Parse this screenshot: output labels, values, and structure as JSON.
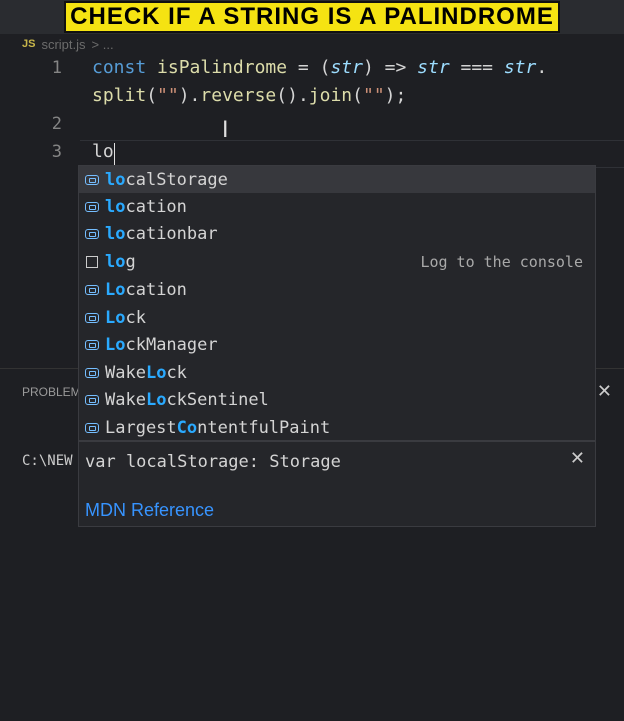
{
  "banner": {
    "title": "CHECK IF A STRING IS A PALINDROME"
  },
  "tab": {
    "badge": "JS",
    "filename": "script.js",
    "breadcrumb_sep": "> ..."
  },
  "editor": {
    "line_numbers": [
      "1",
      "2",
      "3"
    ],
    "line1_a": {
      "const": "const",
      "name": "isPalindrome",
      "eq": " = (",
      "param": "str",
      "arrow": ") => ",
      "param2": "str",
      "cmp": " === ",
      "param3": "str",
      "dot": "."
    },
    "line1_b": {
      "split": "split",
      "a1": "(",
      "s1": "\"\"",
      "a2": ").",
      "reverse": "reverse",
      "a3": "().",
      "join": "join",
      "a4": "(",
      "s2": "\"\"",
      "a5": ");"
    },
    "line3_text": "lo"
  },
  "suggestions": [
    {
      "pre": "lo",
      "post": "calStorage",
      "icon": "variable-icon",
      "detail": ""
    },
    {
      "pre": "lo",
      "post": "cation",
      "icon": "variable-icon",
      "detail": ""
    },
    {
      "pre": "lo",
      "post": "cationbar",
      "icon": "variable-icon",
      "detail": ""
    },
    {
      "pre": "lo",
      "post": "g",
      "icon": "snippet-icon",
      "detail": "Log to the console"
    },
    {
      "pre": "Lo",
      "post": "cation",
      "icon": "variable-icon",
      "detail": ""
    },
    {
      "pre": "Lo",
      "post": "ck",
      "icon": "variable-icon",
      "detail": ""
    },
    {
      "pre": "Lo",
      "post": "ckManager",
      "icon": "variable-icon",
      "detail": ""
    },
    {
      "pre0": "Wake",
      "pre": "Lo",
      "post": "ck",
      "icon": "variable-icon",
      "detail": ""
    },
    {
      "pre0": "Wake",
      "pre": "Lo",
      "post": "ckSentinel",
      "icon": "variable-icon",
      "detail": ""
    },
    {
      "pre0": "Largest",
      "pre": "C",
      "post": "o",
      "post2": "ntentfulPaint",
      "icon": "variable-icon",
      "detail": ""
    }
  ],
  "details": {
    "signature": "var localStorage: Storage",
    "link": "MDN Reference"
  },
  "panel": {
    "tab_label": "PROBLEM",
    "terminal_prompt": "C:\\NEW"
  },
  "colors": {
    "accent": "#2aaaff",
    "banner_bg": "#f5e312"
  }
}
